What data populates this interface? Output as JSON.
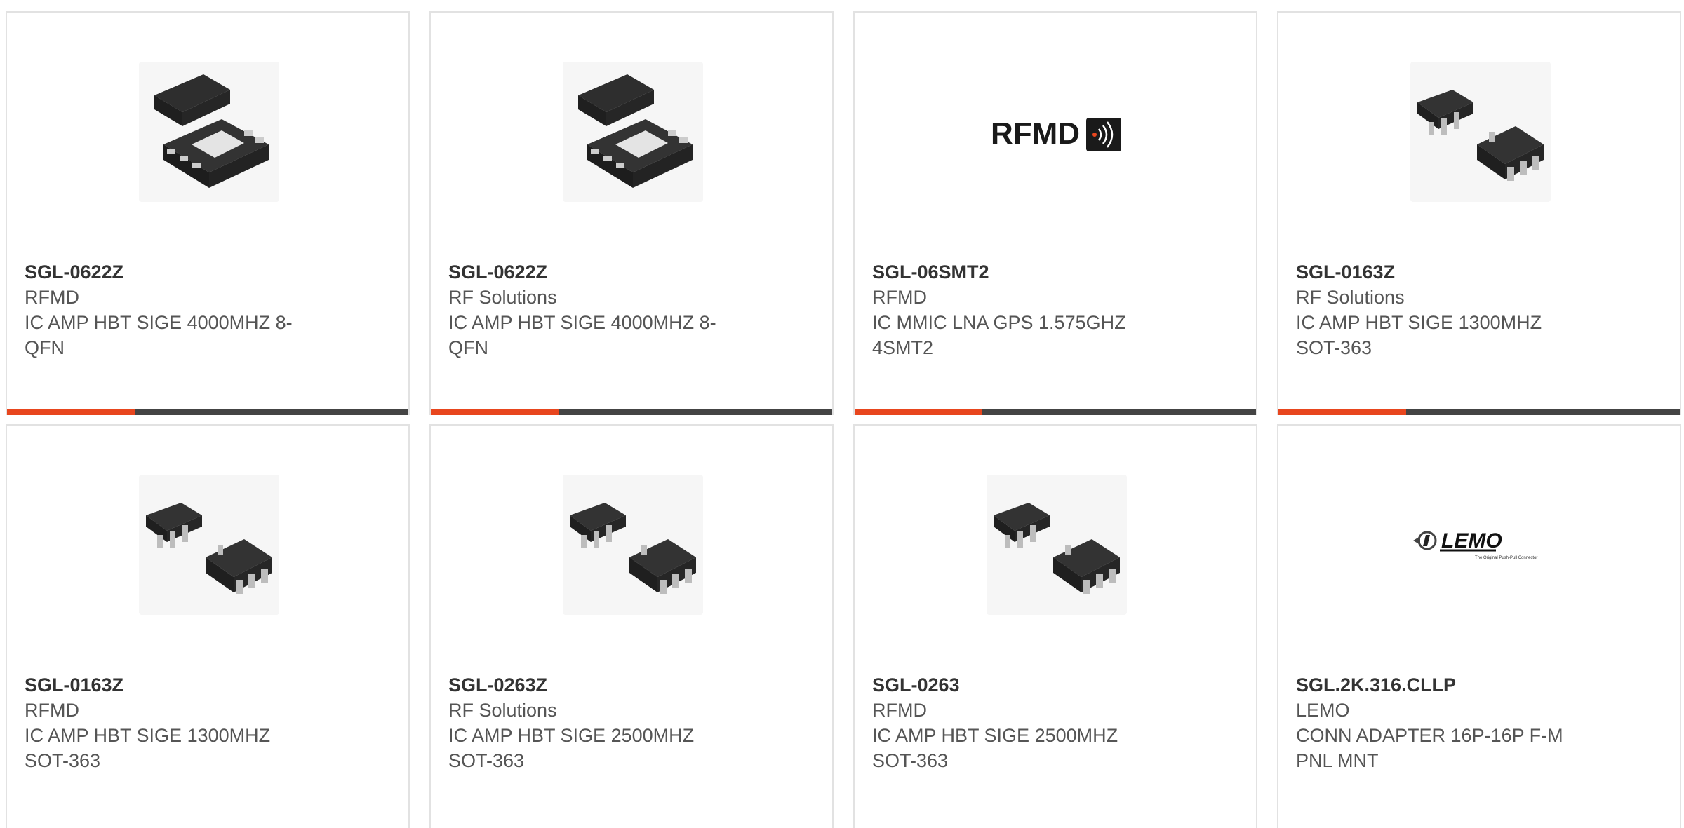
{
  "accent_color": "#e8461e",
  "bar_color": "#444444",
  "products": [
    {
      "part_number": "SGL-0622Z",
      "manufacturer": "RFMD",
      "desc_line1": "IC AMP HBT SIGE 4000MHZ 8-",
      "desc_line2": "QFN",
      "image": "qfn-8-package-icon"
    },
    {
      "part_number": "SGL-0622Z",
      "manufacturer": "RF Solutions",
      "desc_line1": "IC AMP HBT SIGE 4000MHZ 8-",
      "desc_line2": "QFN",
      "image": "qfn-8-package-icon"
    },
    {
      "part_number": "SGL-06SMT2",
      "manufacturer": "RFMD",
      "desc_line1": "IC MMIC LNA GPS 1.575GHZ",
      "desc_line2": "4SMT2",
      "image": "rfmd-logo",
      "logo_text": "RFMD"
    },
    {
      "part_number": "SGL-0163Z",
      "manufacturer": "RF Solutions",
      "desc_line1": "IC AMP HBT SIGE 1300MHZ",
      "desc_line2": "SOT-363",
      "image": "sot-363-package-icon"
    },
    {
      "part_number": "SGL-0163Z",
      "manufacturer": "RFMD",
      "desc_line1": "IC AMP HBT SIGE 1300MHZ",
      "desc_line2": "SOT-363",
      "image": "sot-363-package-icon"
    },
    {
      "part_number": "SGL-0263Z",
      "manufacturer": "RF Solutions",
      "desc_line1": "IC AMP HBT SIGE 2500MHZ",
      "desc_line2": "SOT-363",
      "image": "sot-363-package-icon"
    },
    {
      "part_number": "SGL-0263",
      "manufacturer": "RFMD",
      "desc_line1": "IC AMP HBT SIGE 2500MHZ",
      "desc_line2": "SOT-363",
      "image": "sot-363-package-icon"
    },
    {
      "part_number": "SGL.2K.316.CLLP",
      "manufacturer": "LEMO",
      "desc_line1": "CONN ADAPTER 16P-16P F-M",
      "desc_line2": "PNL MNT",
      "image": "lemo-logo",
      "logo_text": "LEMO",
      "logo_tagline": "The Original Push-Pull Connector"
    }
  ]
}
